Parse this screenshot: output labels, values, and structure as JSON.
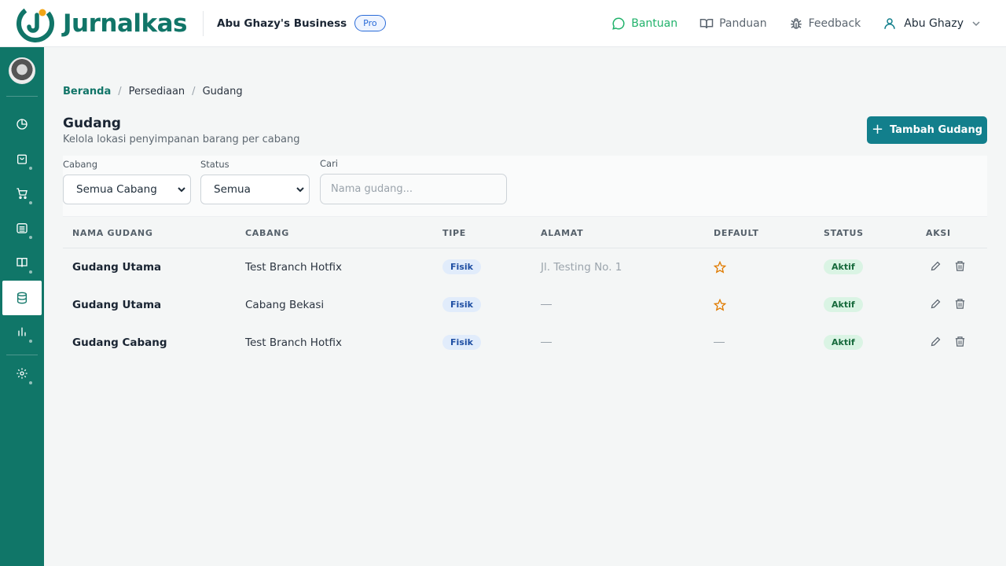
{
  "brand": {
    "name": "Jurnalkas"
  },
  "header": {
    "business": "Abu Ghazy's Business",
    "plan": "Pro",
    "help": "Bantuan",
    "guide": "Panduan",
    "feedback": "Feedback",
    "user": "Abu Ghazy"
  },
  "sidebar": {
    "items": [
      {
        "icon": "chart-pie-icon",
        "has_sub": false
      },
      {
        "icon": "shopping-bag-icon",
        "has_sub": true
      },
      {
        "icon": "cart-icon",
        "has_sub": true
      },
      {
        "icon": "bank-icon",
        "has_sub": true
      },
      {
        "icon": "book-icon",
        "has_sub": true
      },
      {
        "icon": "database-icon",
        "has_sub": true,
        "active": true
      },
      {
        "icon": "bar-chart-icon",
        "has_sub": true
      },
      {
        "icon": "gear-icon",
        "has_sub": true
      }
    ]
  },
  "breadcrumb": {
    "home": "Beranda",
    "section": "Persediaan",
    "current": "Gudang"
  },
  "page": {
    "title": "Gudang",
    "subtitle": "Kelola lokasi penyimpanan barang per cabang",
    "add_button": "Tambah Gudang"
  },
  "filters": {
    "cabang_label": "Cabang",
    "cabang_value": "Semua Cabang",
    "status_label": "Status",
    "status_value": "Semua",
    "search_label": "Cari",
    "search_placeholder": "Nama gudang..."
  },
  "table": {
    "columns": [
      "NAMA GUDANG",
      "CABANG",
      "TIPE",
      "ALAMAT",
      "DEFAULT",
      "STATUS",
      "AKSI"
    ],
    "rows": [
      {
        "name": "Gudang Utama",
        "branch": "Test Branch Hotfix",
        "type": "Fisik",
        "address": "Jl. Testing No. 1",
        "default": true,
        "status": "Aktif"
      },
      {
        "name": "Gudang Utama",
        "branch": "Cabang Bekasi",
        "type": "Fisik",
        "address": "",
        "default": true,
        "status": "Aktif"
      },
      {
        "name": "Gudang Cabang",
        "branch": "Test Branch Hotfix",
        "type": "Fisik",
        "address": "",
        "default": false,
        "status": "Aktif"
      }
    ]
  },
  "colors": {
    "primary": "#107668",
    "button": "#127f8c",
    "star": "#e07b00",
    "help": "#21b26b"
  }
}
